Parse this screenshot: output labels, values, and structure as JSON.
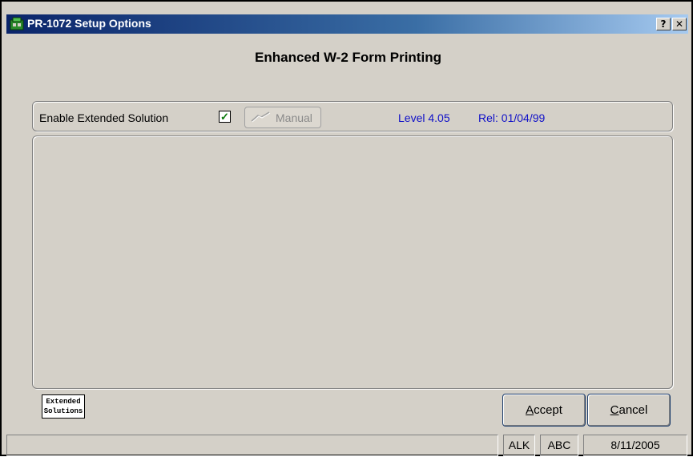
{
  "window": {
    "title": "PR-1072 Setup Options",
    "help_button": "?",
    "close_button": "✕"
  },
  "heading": "Enhanced W-2 Form Printing",
  "options": {
    "enable_label": "Enable Extended Solution",
    "enable_checked": true,
    "check_glyph": "✓",
    "manual_label": "Manual",
    "level": "Level 4.05",
    "release": "Rel: 01/04/99"
  },
  "logo": {
    "line1": "Extended",
    "line2": "Solutions"
  },
  "buttons": {
    "accept": "Accept",
    "cancel": "Cancel"
  },
  "statusbar": {
    "main": "",
    "user": "ALK",
    "company": "ABC",
    "date": "8/11/2005"
  },
  "colors": {
    "title_gradient_start": "#0a246a",
    "title_gradient_end": "#a6caf0",
    "face": "#d4d0c8",
    "info_text": "#1010c8"
  }
}
